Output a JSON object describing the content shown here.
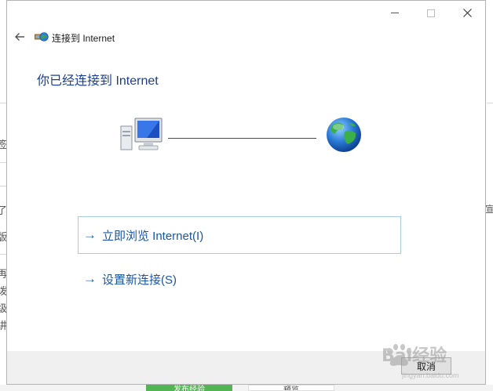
{
  "dialog": {
    "app_title": "连接到 Internet",
    "heading": "你已经连接到 Internet",
    "back_label": "←",
    "window_buttons": {
      "minimize": "—",
      "maximize": "☐",
      "close": "✕"
    },
    "options": [
      {
        "arrow": "→",
        "label": "立即浏览 Internet(I)"
      },
      {
        "arrow": "→",
        "label": "设置新连接(S)"
      }
    ],
    "cancel_label": "取消"
  },
  "background": {
    "left_glyphs": [
      "签",
      "了",
      "版",
      "再",
      "拨",
      "级",
      "讲"
    ],
    "right_glyphs": [
      "宣"
    ],
    "bottom_tabs": [
      "发布经验",
      "预览"
    ]
  },
  "watermark": {
    "text": "Bai经验",
    "sub": "jingyan.baidu.com"
  },
  "icons": {
    "back": "back-arrow-icon",
    "app": "network-connection-icon",
    "computer": "computer-icon",
    "globe": "globe-icon"
  },
  "colors": {
    "heading": "#1c3f8c",
    "link": "#1a56a0",
    "option_border": "#a6cde3",
    "footer": "#f0f0f0"
  }
}
